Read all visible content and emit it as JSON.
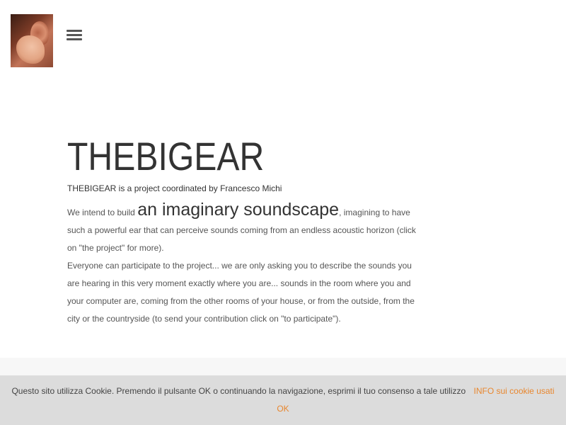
{
  "header": {
    "logo_icon": "ear-hand-photo-icon",
    "menu_icon": "hamburger-menu-icon"
  },
  "main": {
    "title": "THEBIGEAR",
    "subtitle": "THEBIGEAR is a project coordinated by Francesco Michi",
    "intro_before": "We intend to build ",
    "intro_big": "an imaginary soundscape",
    "intro_after": ", imagining to have such a powerful ear that can perceive sounds coming from an endless acoustic horizon (click on \"the project\" for more).",
    "participate": "Everyone can participate to the project... we are only asking you to describe the sounds you are hearing in this very moment exactly where you are... sounds in the room where you and your computer are, coming from the other rooms of your house, or from the outside, from the city or the countryside (to send your contribution click on \"to participate\")."
  },
  "cookie_bar": {
    "message": "Questo sito utilizza Cookie. Premendo il pulsante OK o continuando la navigazione, esprimi il tuo consenso a tale utilizzo",
    "info_link": "INFO sui cookie usati",
    "ok_label": "OK",
    "link_color": "#e8872f",
    "background": "#dcdcdc"
  }
}
